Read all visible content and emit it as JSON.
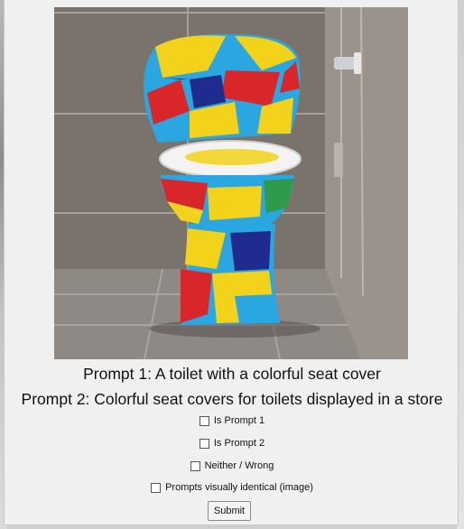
{
  "image": {
    "description_icon": "colorful-toilet-image"
  },
  "prompts": {
    "prompt1": "Prompt 1: A toilet with a colorful seat cover",
    "prompt2": "Prompt 2: Colorful seat covers for toilets displayed in a store"
  },
  "options": [
    {
      "label": "Is Prompt 1",
      "checked": false
    },
    {
      "label": "Is Prompt 2",
      "checked": false
    },
    {
      "label": "Neither / Wrong",
      "checked": false
    },
    {
      "label": "Prompts visually identical (image)",
      "checked": false
    }
  ],
  "submit_label": "Submit",
  "colors": {
    "yellow": "#f2d21a",
    "blue": "#2aa6e0",
    "red": "#d8262b",
    "tile": "#7d7670"
  }
}
